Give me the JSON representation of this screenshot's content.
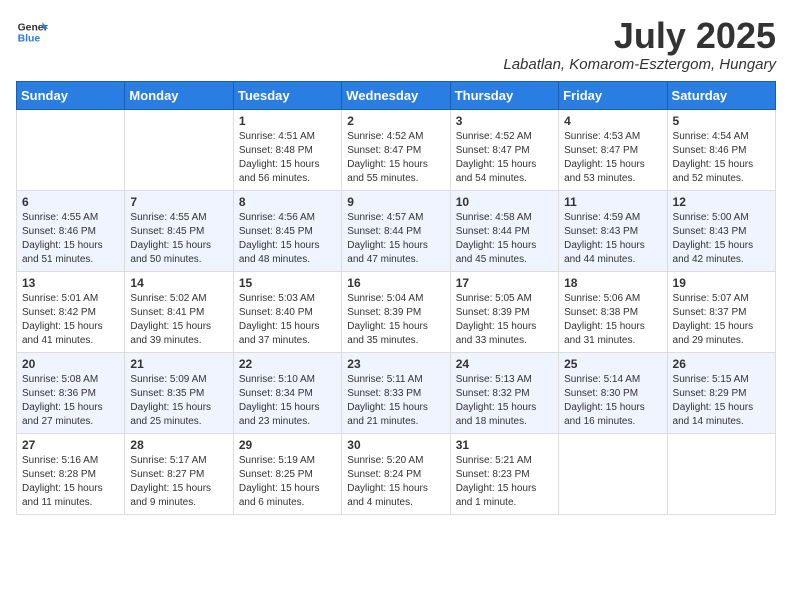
{
  "header": {
    "logo_line1": "General",
    "logo_line2": "Blue",
    "month_year": "July 2025",
    "location": "Labatlan, Komarom-Esztergom, Hungary"
  },
  "days_of_week": [
    "Sunday",
    "Monday",
    "Tuesday",
    "Wednesday",
    "Thursday",
    "Friday",
    "Saturday"
  ],
  "weeks": [
    [
      {
        "day": "",
        "info": ""
      },
      {
        "day": "",
        "info": ""
      },
      {
        "day": "1",
        "info": "Sunrise: 4:51 AM\nSunset: 8:48 PM\nDaylight: 15 hours\nand 56 minutes."
      },
      {
        "day": "2",
        "info": "Sunrise: 4:52 AM\nSunset: 8:47 PM\nDaylight: 15 hours\nand 55 minutes."
      },
      {
        "day": "3",
        "info": "Sunrise: 4:52 AM\nSunset: 8:47 PM\nDaylight: 15 hours\nand 54 minutes."
      },
      {
        "day": "4",
        "info": "Sunrise: 4:53 AM\nSunset: 8:47 PM\nDaylight: 15 hours\nand 53 minutes."
      },
      {
        "day": "5",
        "info": "Sunrise: 4:54 AM\nSunset: 8:46 PM\nDaylight: 15 hours\nand 52 minutes."
      }
    ],
    [
      {
        "day": "6",
        "info": "Sunrise: 4:55 AM\nSunset: 8:46 PM\nDaylight: 15 hours\nand 51 minutes."
      },
      {
        "day": "7",
        "info": "Sunrise: 4:55 AM\nSunset: 8:45 PM\nDaylight: 15 hours\nand 50 minutes."
      },
      {
        "day": "8",
        "info": "Sunrise: 4:56 AM\nSunset: 8:45 PM\nDaylight: 15 hours\nand 48 minutes."
      },
      {
        "day": "9",
        "info": "Sunrise: 4:57 AM\nSunset: 8:44 PM\nDaylight: 15 hours\nand 47 minutes."
      },
      {
        "day": "10",
        "info": "Sunrise: 4:58 AM\nSunset: 8:44 PM\nDaylight: 15 hours\nand 45 minutes."
      },
      {
        "day": "11",
        "info": "Sunrise: 4:59 AM\nSunset: 8:43 PM\nDaylight: 15 hours\nand 44 minutes."
      },
      {
        "day": "12",
        "info": "Sunrise: 5:00 AM\nSunset: 8:43 PM\nDaylight: 15 hours\nand 42 minutes."
      }
    ],
    [
      {
        "day": "13",
        "info": "Sunrise: 5:01 AM\nSunset: 8:42 PM\nDaylight: 15 hours\nand 41 minutes."
      },
      {
        "day": "14",
        "info": "Sunrise: 5:02 AM\nSunset: 8:41 PM\nDaylight: 15 hours\nand 39 minutes."
      },
      {
        "day": "15",
        "info": "Sunrise: 5:03 AM\nSunset: 8:40 PM\nDaylight: 15 hours\nand 37 minutes."
      },
      {
        "day": "16",
        "info": "Sunrise: 5:04 AM\nSunset: 8:39 PM\nDaylight: 15 hours\nand 35 minutes."
      },
      {
        "day": "17",
        "info": "Sunrise: 5:05 AM\nSunset: 8:39 PM\nDaylight: 15 hours\nand 33 minutes."
      },
      {
        "day": "18",
        "info": "Sunrise: 5:06 AM\nSunset: 8:38 PM\nDaylight: 15 hours\nand 31 minutes."
      },
      {
        "day": "19",
        "info": "Sunrise: 5:07 AM\nSunset: 8:37 PM\nDaylight: 15 hours\nand 29 minutes."
      }
    ],
    [
      {
        "day": "20",
        "info": "Sunrise: 5:08 AM\nSunset: 8:36 PM\nDaylight: 15 hours\nand 27 minutes."
      },
      {
        "day": "21",
        "info": "Sunrise: 5:09 AM\nSunset: 8:35 PM\nDaylight: 15 hours\nand 25 minutes."
      },
      {
        "day": "22",
        "info": "Sunrise: 5:10 AM\nSunset: 8:34 PM\nDaylight: 15 hours\nand 23 minutes."
      },
      {
        "day": "23",
        "info": "Sunrise: 5:11 AM\nSunset: 8:33 PM\nDaylight: 15 hours\nand 21 minutes."
      },
      {
        "day": "24",
        "info": "Sunrise: 5:13 AM\nSunset: 8:32 PM\nDaylight: 15 hours\nand 18 minutes."
      },
      {
        "day": "25",
        "info": "Sunrise: 5:14 AM\nSunset: 8:30 PM\nDaylight: 15 hours\nand 16 minutes."
      },
      {
        "day": "26",
        "info": "Sunrise: 5:15 AM\nSunset: 8:29 PM\nDaylight: 15 hours\nand 14 minutes."
      }
    ],
    [
      {
        "day": "27",
        "info": "Sunrise: 5:16 AM\nSunset: 8:28 PM\nDaylight: 15 hours\nand 11 minutes."
      },
      {
        "day": "28",
        "info": "Sunrise: 5:17 AM\nSunset: 8:27 PM\nDaylight: 15 hours\nand 9 minutes."
      },
      {
        "day": "29",
        "info": "Sunrise: 5:19 AM\nSunset: 8:25 PM\nDaylight: 15 hours\nand 6 minutes."
      },
      {
        "day": "30",
        "info": "Sunrise: 5:20 AM\nSunset: 8:24 PM\nDaylight: 15 hours\nand 4 minutes."
      },
      {
        "day": "31",
        "info": "Sunrise: 5:21 AM\nSunset: 8:23 PM\nDaylight: 15 hours\nand 1 minute."
      },
      {
        "day": "",
        "info": ""
      },
      {
        "day": "",
        "info": ""
      }
    ]
  ]
}
